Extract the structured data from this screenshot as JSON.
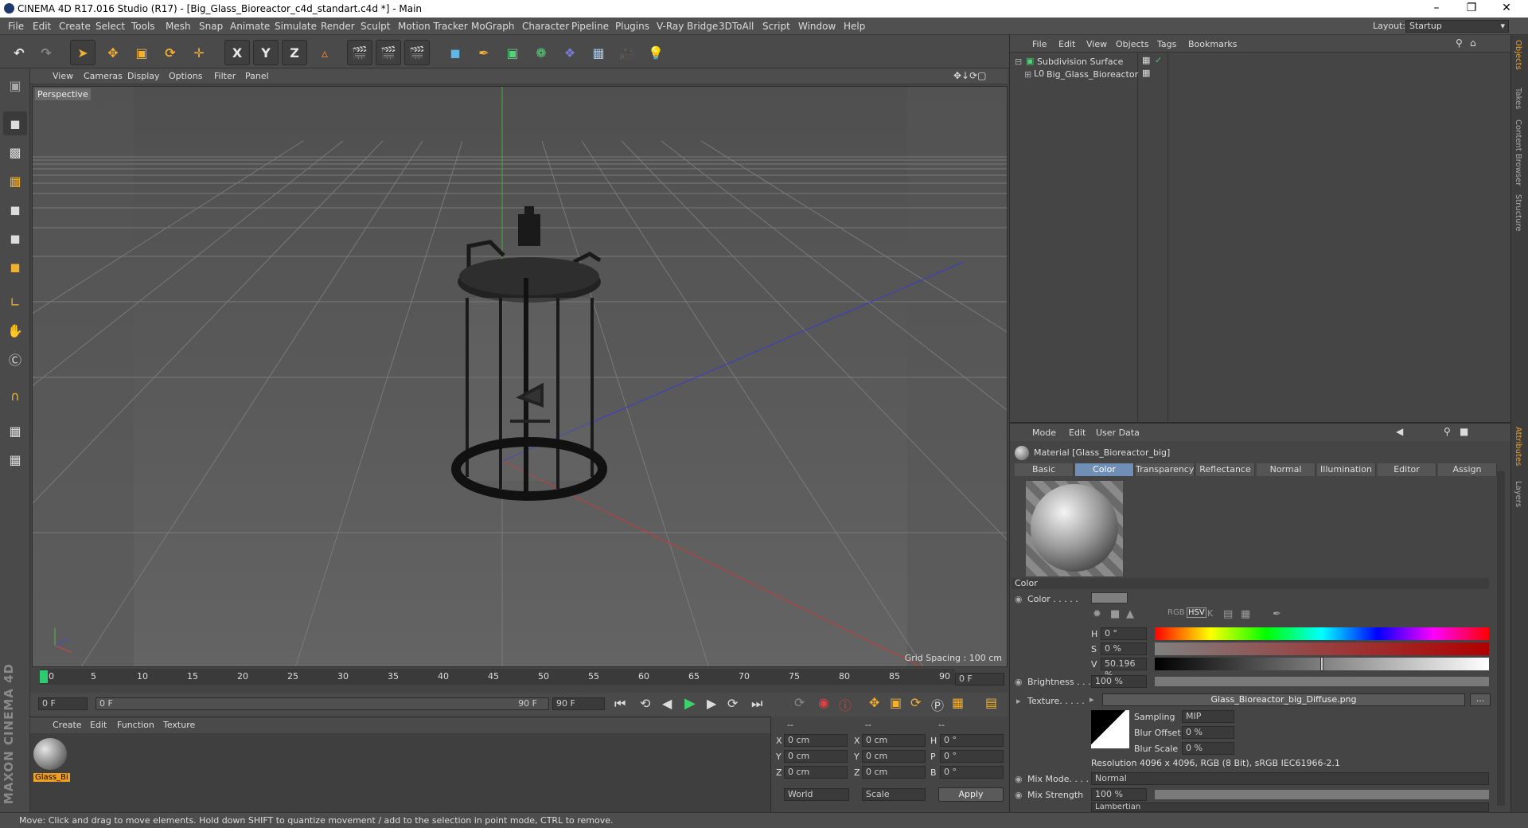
{
  "window": {
    "title": "CINEMA 4D R17.016 Studio (R17) - [Big_Glass_Bioreactor_c4d_standart.c4d *] - Main"
  },
  "menubar": {
    "items": [
      "File",
      "Edit",
      "Create",
      "Select",
      "Tools",
      "Mesh",
      "Snap",
      "Animate",
      "Simulate",
      "Render",
      "Sculpt",
      "Motion Tracker",
      "MoGraph",
      "Character",
      "Pipeline",
      "Plugins",
      "V-Ray Bridge",
      "3DToAll",
      "Script",
      "Window",
      "Help"
    ],
    "layout_label": "Layout:",
    "layout_value": "Startup"
  },
  "toolbar": {
    "x": "X",
    "y": "Y",
    "z": "Z"
  },
  "viewport": {
    "menu": [
      "View",
      "Cameras",
      "Display",
      "Options",
      "Filter",
      "Panel"
    ],
    "label": "Perspective",
    "grid_spacing": "Grid Spacing : 100 cm"
  },
  "timeline": {
    "ticks": [
      "0",
      "5",
      "10",
      "15",
      "20",
      "25",
      "30",
      "35",
      "40",
      "45",
      "50",
      "55",
      "60",
      "65",
      "70",
      "75",
      "80",
      "85",
      "90"
    ],
    "current_frame": "0 F",
    "start": "0 F",
    "slider_start": "0 F",
    "slider_end": "90 F",
    "end": "90 F"
  },
  "material_manager": {
    "menu": [
      "Create",
      "Edit",
      "Function",
      "Texture"
    ],
    "material_name": "Glass_Bi"
  },
  "coord_manager": {
    "headers": [
      "--",
      "--",
      "--"
    ],
    "rows": [
      {
        "a": "X",
        "av": "0 cm",
        "b": "X",
        "bv": "0 cm",
        "c": "H",
        "cv": "0 °"
      },
      {
        "a": "Y",
        "av": "0 cm",
        "b": "Y",
        "bv": "0 cm",
        "c": "P",
        "cv": "0 °"
      },
      {
        "a": "Z",
        "av": "0 cm",
        "b": "Z",
        "bv": "0 cm",
        "c": "B",
        "cv": "0 °"
      }
    ],
    "world": "World",
    "scale": "Scale",
    "apply": "Apply"
  },
  "status": "Move: Click and drag to move elements. Hold down SHIFT to quantize movement / add to the selection in point mode, CTRL to remove.",
  "object_manager": {
    "menu": [
      "File",
      "Edit",
      "View",
      "Objects",
      "Tags",
      "Bookmarks"
    ],
    "objects": [
      "Subdivision Surface",
      "Big_Glass_Bioreactor"
    ]
  },
  "attribute_manager": {
    "menu": [
      "Mode",
      "Edit",
      "User Data"
    ],
    "title": "Material [Glass_Bioreactor_big]",
    "tabs": [
      "Basic",
      "Color",
      "Transparency",
      "Reflectance",
      "Normal",
      "Illumination",
      "Editor",
      "Assign"
    ],
    "section": "Color",
    "color_label": "Color . . . . .",
    "h_label": "H",
    "h_value": "0 °",
    "s_label": "S",
    "s_value": "0 %",
    "v_label": "V",
    "v_value": "50.196 %",
    "v_level": 0.50196,
    "brightness_label": "Brightness . . .",
    "brightness_value": "100 %",
    "texture_label": "Texture. . . . .",
    "texture_file": "Glass_Bioreactor_big_Diffuse.png",
    "sampling_label": "Sampling",
    "sampling_value": "MIP",
    "blur_offset_label": "Blur Offset",
    "blur_offset_value": "0 %",
    "blur_scale_label": "Blur Scale",
    "blur_scale_value": "0 %",
    "resolution": "Resolution 4096 x 4096, RGB (8 Bit), sRGB IEC61966-2.1",
    "mix_mode_label": "Mix Mode. . . . .",
    "mix_mode_value": "Normal",
    "mix_strength_label": "Mix Strength",
    "mix_strength_value": "100 %",
    "model_value": "Lambertian"
  },
  "side_tabs": [
    "Objects",
    "Takes",
    "Content Browser",
    "Structure"
  ],
  "side_tabs_lower": [
    "Attributes",
    "Layers"
  ],
  "branding": "MAXON CINEMA 4D"
}
